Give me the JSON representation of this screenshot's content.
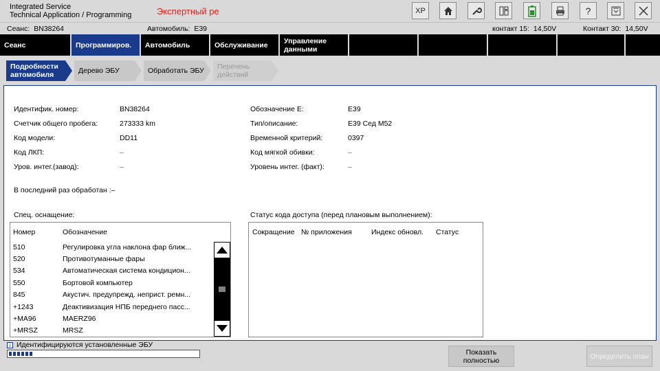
{
  "titlebar": {
    "app_title_line1": "Integrated Service",
    "app_title_line2": "Technical Application / Programming",
    "mode_title": "Экспертный ре",
    "toolbar": {
      "xp_label": "XP",
      "help_label": "?"
    }
  },
  "infobar": {
    "session_label": "Сеанс:",
    "session_value": "BN38264",
    "vehicle_label": "Автомобиль:",
    "vehicle_value": "E39",
    "k15_label": "контакт 15:",
    "k15_value": "14,50V",
    "k30_label": "Контакт 30:",
    "k30_value": "14,50V"
  },
  "mainnav": {
    "items": [
      {
        "label": "Сеанс"
      },
      {
        "label": "Программиров."
      },
      {
        "label": "Автомобиль"
      },
      {
        "label": "Обслуживание"
      },
      {
        "label": "Управление данными"
      }
    ]
  },
  "subtabs": [
    {
      "label": "Подробности автомобиля"
    },
    {
      "label": "Дерево ЭБУ"
    },
    {
      "label": "Обработать ЭБУ"
    },
    {
      "label": "Перечень действий"
    }
  ],
  "details": {
    "id_label": "Идентифик. номер:",
    "id_value": "BN38264",
    "mileage_label": "Счетчик общего пробега:",
    "mileage_value": "273333 km",
    "model_label": "Код модели:",
    "model_value": "DD11",
    "paint_label": "Код ЛКП:",
    "paint_value": "–",
    "integ_plant_label": "Уров. интег.(завод):",
    "integ_plant_value": "–",
    "e_label": "Обозначение E:",
    "e_value": "E39",
    "type_label": "Тип/описание:",
    "type_value": "E39 Сед M52",
    "time_label": "Временной критерий:",
    "time_value": "0397",
    "upholstery_label": "Код мягкой обивки:",
    "upholstery_value": "–",
    "integ_actual_label": "Уровень интег. (факт):",
    "integ_actual_value": "–",
    "last_processed": "В последний раз обработан :–"
  },
  "equipment": {
    "title": "Спец. оснащение:",
    "col_number": "Номер",
    "col_name": "Обозначение",
    "rows": [
      {
        "number": "510",
        "name": "Регулировка угла наклона фар ближ..."
      },
      {
        "number": "520",
        "name": "Противотуманные фары"
      },
      {
        "number": "534",
        "name": "Автоматическая система кондицион..."
      },
      {
        "number": "550",
        "name": "Бортовой компьютер"
      },
      {
        "number": "845",
        "name": "Акустич. предупрежд. неприст. ремн..."
      },
      {
        "number": "+1243",
        "name": "Деактивизация НПБ переднего пасс..."
      },
      {
        "number": "+MA96",
        "name": "MAERZ96"
      },
      {
        "number": "+MRSZ",
        "name": "MRSZ"
      }
    ]
  },
  "access_status": {
    "title": "Статус кода доступа (перед плановым выполнением):",
    "col_abbr": "Сокращение",
    "col_app": "№ приложения",
    "col_index": "Индекс обновл.",
    "col_status": "Статус"
  },
  "statusbar": {
    "message": "Идентифицируются установленные ЭБУ",
    "progress_segments": 6
  },
  "buttons": {
    "show_full": "Показать полностью",
    "determine_plan": "Определить план"
  }
}
